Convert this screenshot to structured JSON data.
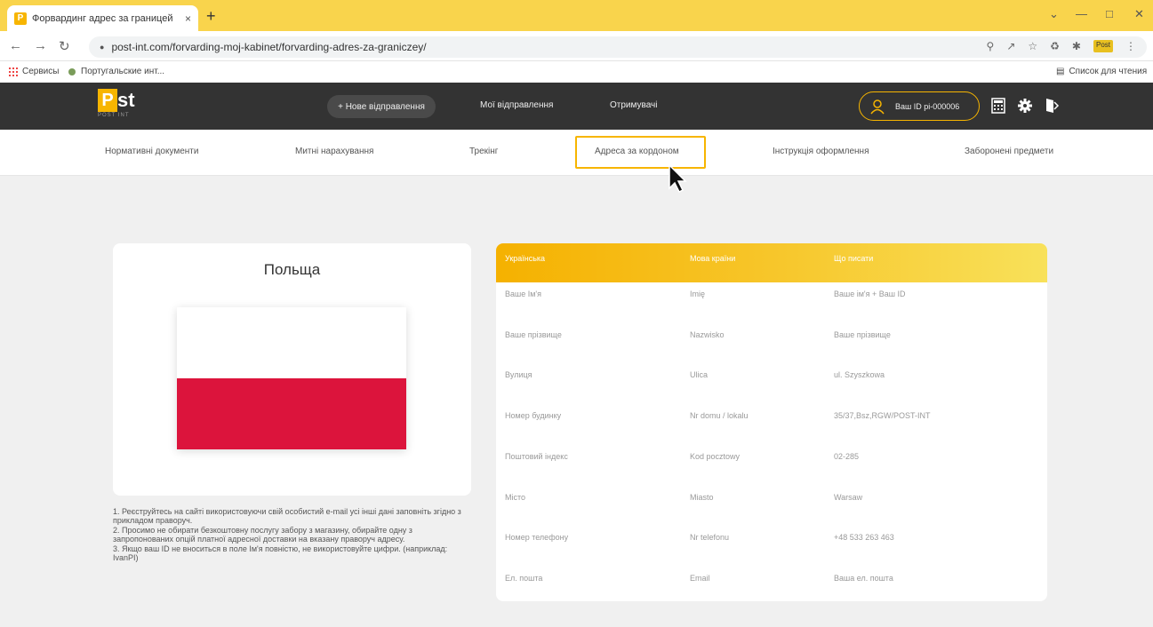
{
  "browser": {
    "tab_title": "Форвардинг адрес за границей",
    "tab_favicon": "P",
    "tab_close": "×",
    "new_tab": "+",
    "url": "post-int.com/forvarding-moj-kabinet/forvarding-adres-za-graniczey/",
    "extension_badge": "Post",
    "bookmarks": [
      {
        "label": "Сервисы",
        "icon": "apps-grid-icon"
      },
      {
        "label": "Португальские инт...",
        "icon": "bookmark-favicon-icon"
      }
    ],
    "reading_list": "Список для чтения"
  },
  "site": {
    "logo_letter": "P",
    "logo_text": "st",
    "logo_sub": "POST INT",
    "new_shipment": "+ Нове відправлення",
    "nav": [
      "Мої відправлення",
      "Отримувачі"
    ],
    "user_id": "Ваш ID pi-000006",
    "subnav": [
      "Нормативні документи",
      "Митні нарахування",
      "Трекінг",
      "Адреса за кордоном",
      "Інструкція оформлення",
      "Заборонені предмети"
    ]
  },
  "country_card": {
    "title": "Польща",
    "flag_colors": [
      "#ffffff",
      "#dc143c"
    ]
  },
  "notes": [
    "1. Реєструйтесь на сайті використовуючи свій особистий e-mail усі інші дані заповніть згідно з прикладом праворуч.",
    "2. Просимо не обирати безкоштовну послугу забору з магазину, обирайте одну з запропонованих опцій платної адресної доставки на вказану праворуч адресу.",
    "3. Якщо ваш ID не вноситься в поле Ім'я повністю, не використовуйте цифри. (наприклад: IvanPI)"
  ],
  "address_table": {
    "headers": [
      "Українська",
      "Мова країни",
      "Що писати"
    ],
    "rows": [
      [
        "Ваше Ім'я",
        "Imię",
        "Ваше ім'я + Ваш ID"
      ],
      [
        "Ваше прізвище",
        "Nazwisko",
        "Ваше прізвище"
      ],
      [
        "Вулиця",
        "Ulica",
        "ul. Szyszkowa"
      ],
      [
        "Номер будинку",
        "Nr domu / lokalu",
        "35/37,Bsz,RGW/POST-INT"
      ],
      [
        "Поштовий індекс",
        "Kod pocztowy",
        "02-285"
      ],
      [
        "Місто",
        "Miasto",
        "Warsaw"
      ],
      [
        "Номер телефону",
        "Nr telefonu",
        "+48 533 263 463"
      ],
      [
        "Ел. пошта",
        "Email",
        "Ваша ел. пошта"
      ]
    ]
  },
  "colors": {
    "accent": "#f7b500",
    "header_bg": "#333333",
    "tabbar_bg": "#f9d44c"
  }
}
